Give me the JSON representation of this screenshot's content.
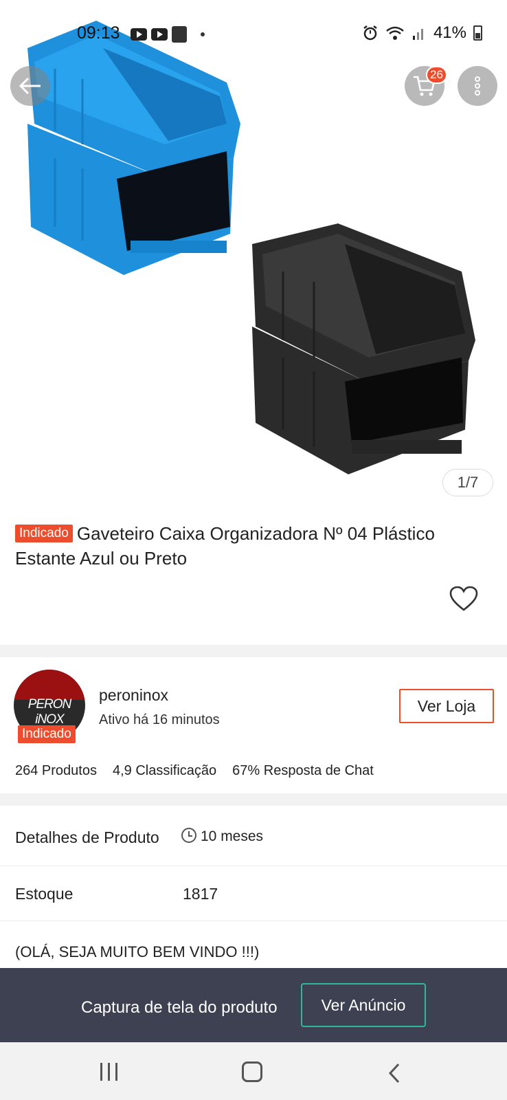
{
  "status_bar": {
    "time": "09:13",
    "battery": "41%"
  },
  "header": {
    "cart_count": "26"
  },
  "gallery": {
    "counter": "1/7"
  },
  "product": {
    "tag": "Indicado",
    "title": "Gaveteiro Caixa Organizadora Nº 04 Plástico Estante Azul ou Preto"
  },
  "shop": {
    "logo_text": "PERON iNOX",
    "tag": "Indicado",
    "name": "peroninox",
    "active": "Ativo há 16 minutos",
    "button": "Ver Loja",
    "stats": [
      "264 Produtos",
      "4,9 Classificação",
      "67% Resposta de Chat"
    ]
  },
  "details": {
    "label": "Detalhes de Produto",
    "age": "10 meses",
    "stock_label": "Estoque",
    "stock_value": "1817",
    "welcome": "(OLÁ, SEJA MUITO BEM VINDO !!!)"
  },
  "banner": {
    "text": "Captura de tela do produto",
    "button": "Ver Anúncio"
  },
  "colors": {
    "accent": "#ee4d2d",
    "banner_bg": "#3d4152",
    "banner_button_border": "#2fb89a"
  }
}
